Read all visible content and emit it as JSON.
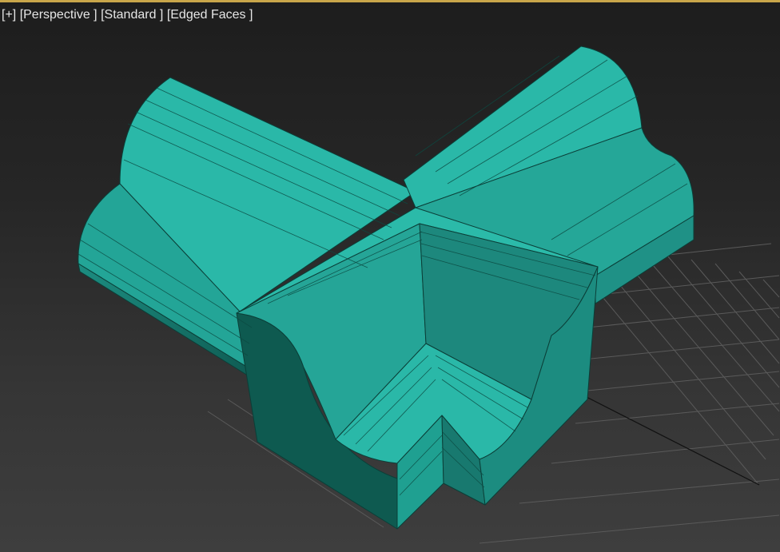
{
  "viewport": {
    "menus": [
      {
        "label": "[+]"
      },
      {
        "label": "[Perspective ]"
      },
      {
        "label": "[Standard ]"
      },
      {
        "label": "[Edged Faces ]"
      }
    ]
  },
  "colors": {
    "active_border": "#c9a64a",
    "mesh_base": "#2ab8a8",
    "mesh_dark": "#0e5a50",
    "mesh_mid": "#1f9488",
    "edge": "#0b3f38",
    "grid": "#5a5a5a"
  }
}
